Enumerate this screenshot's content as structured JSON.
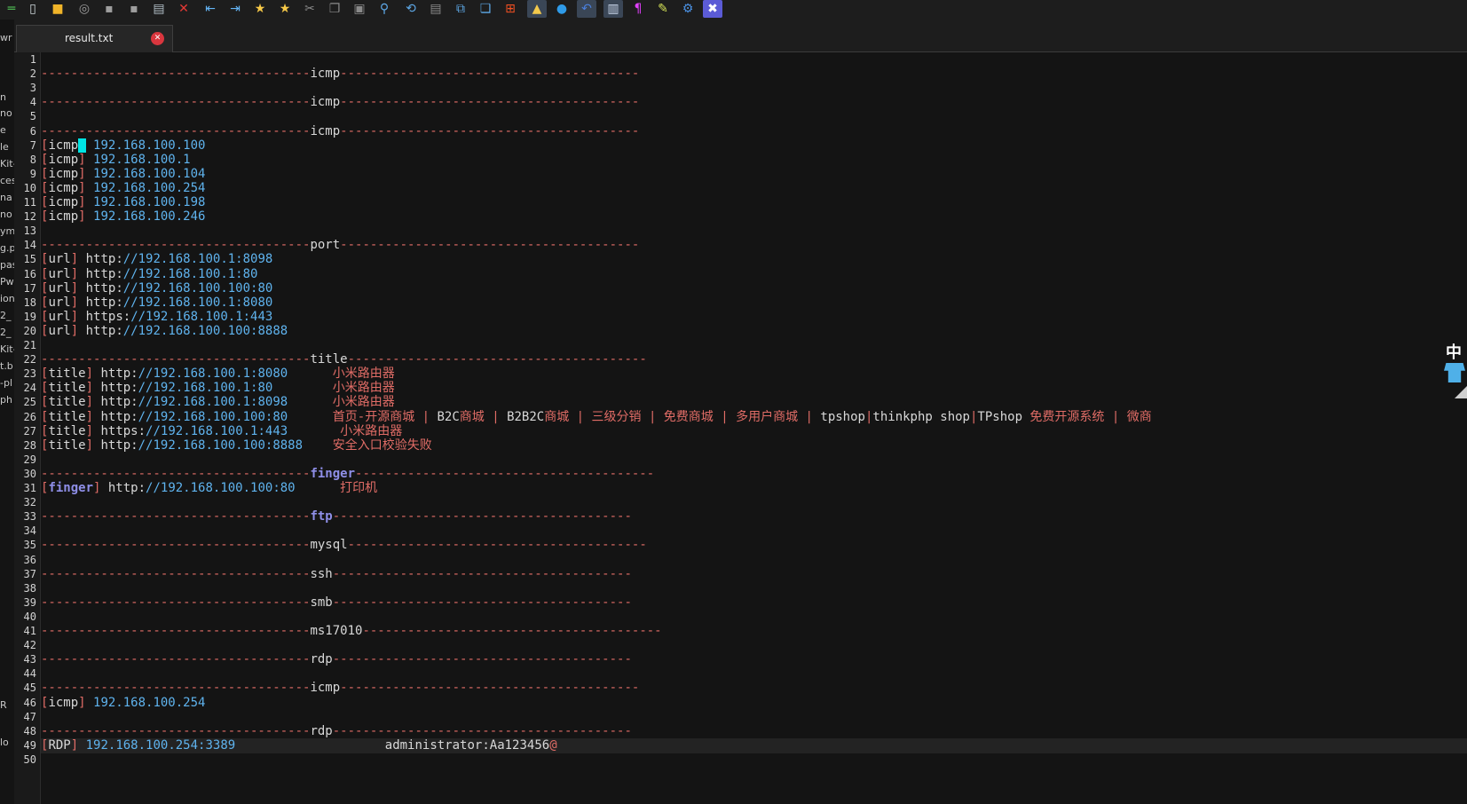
{
  "toolbar": {
    "buttons": [
      {
        "name": "menu-edge-icon",
        "glyph": "═",
        "color": "#4caf50"
      },
      {
        "name": "new-file-icon",
        "glyph": "▯",
        "color": "#cfd8dc"
      },
      {
        "name": "open-folder-icon",
        "glyph": "■",
        "color": "#f0b429"
      },
      {
        "name": "reload-icon",
        "glyph": "◎",
        "color": "#9e9e9e"
      },
      {
        "name": "save-icon",
        "glyph": "▪",
        "color": "#9e9e9e"
      },
      {
        "name": "save-all-icon",
        "glyph": "▪",
        "color": "#9e9e9e"
      },
      {
        "name": "print-icon",
        "glyph": "▤",
        "color": "#b0bec5"
      },
      {
        "name": "close-icon",
        "glyph": "✕",
        "color": "#e53935"
      },
      {
        "name": "unindent-icon",
        "glyph": "⇤",
        "color": "#64b5f6"
      },
      {
        "name": "indent-icon",
        "glyph": "⇥",
        "color": "#64b5f6"
      },
      {
        "name": "bookmark-icon",
        "glyph": "★",
        "color": "#f7c948"
      },
      {
        "name": "bookmark-next-icon",
        "glyph": "★",
        "color": "#f7c948"
      },
      {
        "name": "cut-icon",
        "glyph": "✂",
        "color": "#8a8a8a"
      },
      {
        "name": "copy-icon",
        "glyph": "❐",
        "color": "#8a8a8a"
      },
      {
        "name": "paste-icon",
        "glyph": "▣",
        "color": "#8a8a8a"
      },
      {
        "name": "find-icon",
        "glyph": "⚲",
        "color": "#5ea9e8"
      },
      {
        "name": "find-replace-icon",
        "glyph": "⟲",
        "color": "#5ea9e8"
      },
      {
        "name": "document-icon",
        "glyph": "▤",
        "color": "#8a8a8a"
      },
      {
        "name": "compare-icon",
        "glyph": "⧉",
        "color": "#5ea9e8"
      },
      {
        "name": "window-icon",
        "glyph": "❏",
        "color": "#5ea9e8"
      },
      {
        "name": "windows-logo-icon",
        "glyph": "⊞",
        "color": "#f25022"
      },
      {
        "name": "linux-icon",
        "glyph": "▲",
        "color": "#f2c94c",
        "pressed": true
      },
      {
        "name": "apple-icon",
        "glyph": "●",
        "color": "#2f9be8"
      },
      {
        "name": "undo-icon",
        "glyph": "↶",
        "color": "#4a7fdc",
        "pressed": true
      },
      {
        "name": "panel-icon",
        "glyph": "▥",
        "color": "#c9d6ea",
        "pressed": true
      },
      {
        "name": "pilcrow-icon",
        "glyph": "¶",
        "color": "#e040fb"
      },
      {
        "name": "pen-icon",
        "glyph": "✎",
        "color": "#d4e157"
      },
      {
        "name": "settings-icon",
        "glyph": "⚙",
        "color": "#4a90e2"
      },
      {
        "name": "close-box-icon",
        "glyph": "✖",
        "color": "#ffffff",
        "bg": "#5b5bd6"
      }
    ]
  },
  "left_strip": [
    "wr",
    "n",
    "no",
    "e",
    "le",
    "Kit-",
    "ces",
    "na",
    "no",
    "ym",
    "g.p",
    "pas",
    "Pwo",
    "ion",
    "2_",
    "2_",
    "Kit-",
    "t.b",
    "-pl",
    "ph",
    "R",
    "lo"
  ],
  "tab": {
    "label": "result.txt",
    "close_glyph": "✕"
  },
  "colors": {
    "accent_dash": "#e06c66",
    "ip_blue": "#5fb3ee",
    "finger_purple": "#8f8fe8",
    "cursor": "#00e5e5"
  },
  "lines": [
    {
      "n": "1",
      "segs": []
    },
    {
      "n": "2",
      "segs": [
        {
          "t": "------------------------------------",
          "c": "dash"
        },
        {
          "t": "icmp",
          "c": "tag"
        },
        {
          "t": "----------------------------------------",
          "c": "dash"
        }
      ]
    },
    {
      "n": "3",
      "segs": []
    },
    {
      "n": "4",
      "segs": [
        {
          "t": "------------------------------------",
          "c": "dash"
        },
        {
          "t": "icmp",
          "c": "tag"
        },
        {
          "t": "----------------------------------------",
          "c": "dash"
        }
      ]
    },
    {
      "n": "5",
      "segs": []
    },
    {
      "n": "6",
      "segs": [
        {
          "t": "------------------------------------",
          "c": "dash"
        },
        {
          "t": "icmp",
          "c": "tag"
        },
        {
          "t": "----------------------------------------",
          "c": "dash"
        }
      ]
    },
    {
      "n": "7",
      "segs": [
        {
          "t": "[",
          "c": "br"
        },
        {
          "t": "icmp",
          "c": "tag"
        },
        {
          "t": "]",
          "c": "cursor"
        },
        {
          "t": " 192.168.100.100",
          "c": "ip"
        }
      ]
    },
    {
      "n": "8",
      "segs": [
        {
          "t": "[",
          "c": "br"
        },
        {
          "t": "icmp",
          "c": "tag"
        },
        {
          "t": "]",
          "c": "br"
        },
        {
          "t": " 192.168.100.1",
          "c": "ip"
        }
      ]
    },
    {
      "n": "9",
      "segs": [
        {
          "t": "[",
          "c": "br"
        },
        {
          "t": "icmp",
          "c": "tag"
        },
        {
          "t": "]",
          "c": "br"
        },
        {
          "t": " 192.168.100.104",
          "c": "ip"
        }
      ]
    },
    {
      "n": "10",
      "segs": [
        {
          "t": "[",
          "c": "br"
        },
        {
          "t": "icmp",
          "c": "tag"
        },
        {
          "t": "]",
          "c": "br"
        },
        {
          "t": " 192.168.100.254",
          "c": "ip"
        }
      ]
    },
    {
      "n": "11",
      "segs": [
        {
          "t": "[",
          "c": "br"
        },
        {
          "t": "icmp",
          "c": "tag"
        },
        {
          "t": "]",
          "c": "br"
        },
        {
          "t": " 192.168.100.198",
          "c": "ip"
        }
      ]
    },
    {
      "n": "12",
      "segs": [
        {
          "t": "[",
          "c": "br"
        },
        {
          "t": "icmp",
          "c": "tag"
        },
        {
          "t": "]",
          "c": "br"
        },
        {
          "t": " 192.168.100.246",
          "c": "ip"
        }
      ]
    },
    {
      "n": "13",
      "segs": []
    },
    {
      "n": "14",
      "segs": [
        {
          "t": "------------------------------------",
          "c": "dash"
        },
        {
          "t": "port",
          "c": "tag"
        },
        {
          "t": "----------------------------------------",
          "c": "dash"
        }
      ]
    },
    {
      "n": "15",
      "segs": [
        {
          "t": "[",
          "c": "br"
        },
        {
          "t": "url",
          "c": "tag"
        },
        {
          "t": "]",
          "c": "br"
        },
        {
          "t": " http:",
          "c": "url"
        },
        {
          "t": "//192.168.100.1:8098",
          "c": "url-rest"
        }
      ]
    },
    {
      "n": "16",
      "segs": [
        {
          "t": "[",
          "c": "br"
        },
        {
          "t": "url",
          "c": "tag"
        },
        {
          "t": "]",
          "c": "br"
        },
        {
          "t": " http:",
          "c": "url"
        },
        {
          "t": "//192.168.100.1:80",
          "c": "url-rest"
        }
      ]
    },
    {
      "n": "17",
      "segs": [
        {
          "t": "[",
          "c": "br"
        },
        {
          "t": "url",
          "c": "tag"
        },
        {
          "t": "]",
          "c": "br"
        },
        {
          "t": " http:",
          "c": "url"
        },
        {
          "t": "//192.168.100.100:80",
          "c": "url-rest"
        }
      ]
    },
    {
      "n": "18",
      "segs": [
        {
          "t": "[",
          "c": "br"
        },
        {
          "t": "url",
          "c": "tag"
        },
        {
          "t": "]",
          "c": "br"
        },
        {
          "t": " http:",
          "c": "url"
        },
        {
          "t": "//192.168.100.1:8080",
          "c": "url-rest"
        }
      ]
    },
    {
      "n": "19",
      "segs": [
        {
          "t": "[",
          "c": "br"
        },
        {
          "t": "url",
          "c": "tag"
        },
        {
          "t": "]",
          "c": "br"
        },
        {
          "t": " https:",
          "c": "url"
        },
        {
          "t": "//192.168.100.1:443",
          "c": "url-rest"
        }
      ]
    },
    {
      "n": "20",
      "segs": [
        {
          "t": "[",
          "c": "br"
        },
        {
          "t": "url",
          "c": "tag"
        },
        {
          "t": "]",
          "c": "br"
        },
        {
          "t": " http:",
          "c": "url"
        },
        {
          "t": "//192.168.100.100:8888",
          "c": "url-rest"
        }
      ]
    },
    {
      "n": "21",
      "segs": []
    },
    {
      "n": "22",
      "segs": [
        {
          "t": "------------------------------------",
          "c": "dash"
        },
        {
          "t": "title",
          "c": "tag"
        },
        {
          "t": "----------------------------------------",
          "c": "dash"
        }
      ]
    },
    {
      "n": "23",
      "segs": [
        {
          "t": "[",
          "c": "br"
        },
        {
          "t": "title",
          "c": "tag"
        },
        {
          "t": "]",
          "c": "br"
        },
        {
          "t": " http:",
          "c": "url"
        },
        {
          "t": "//192.168.100.1:8080",
          "c": "url-rest"
        },
        {
          "t": "      小米路由器",
          "c": "cn"
        }
      ]
    },
    {
      "n": "24",
      "segs": [
        {
          "t": "[",
          "c": "br"
        },
        {
          "t": "title",
          "c": "tag"
        },
        {
          "t": "]",
          "c": "br"
        },
        {
          "t": " http:",
          "c": "url"
        },
        {
          "t": "//192.168.100.1:80",
          "c": "url-rest"
        },
        {
          "t": "        小米路由器",
          "c": "cn"
        }
      ]
    },
    {
      "n": "25",
      "segs": [
        {
          "t": "[",
          "c": "br"
        },
        {
          "t": "title",
          "c": "tag"
        },
        {
          "t": "]",
          "c": "br"
        },
        {
          "t": " http:",
          "c": "url"
        },
        {
          "t": "//192.168.100.1:8098",
          "c": "url-rest"
        },
        {
          "t": "      小米路由器",
          "c": "cn"
        }
      ]
    },
    {
      "n": "26",
      "segs": [
        {
          "t": "[",
          "c": "br"
        },
        {
          "t": "title",
          "c": "tag"
        },
        {
          "t": "]",
          "c": "br"
        },
        {
          "t": " http:",
          "c": "url"
        },
        {
          "t": "//192.168.100.100:80",
          "c": "url-rest"
        },
        {
          "t": "      首页-开源商城 | ",
          "c": "cn"
        },
        {
          "t": "B2C",
          "c": "sep"
        },
        {
          "t": "商城 | ",
          "c": "cn"
        },
        {
          "t": "B2B2C",
          "c": "sep"
        },
        {
          "t": "商城 | 三级分销 | 免费商城 | 多用户商城 | ",
          "c": "cn"
        },
        {
          "t": "tpshop",
          "c": "sep"
        },
        {
          "t": "|",
          "c": "cn"
        },
        {
          "t": "thinkphp shop",
          "c": "sep"
        },
        {
          "t": "|",
          "c": "cn"
        },
        {
          "t": "TPshop",
          "c": "sep"
        },
        {
          "t": " 免费开源系统 | 微商",
          "c": "cn"
        }
      ]
    },
    {
      "n": "27",
      "segs": [
        {
          "t": "[",
          "c": "br"
        },
        {
          "t": "title",
          "c": "tag"
        },
        {
          "t": "]",
          "c": "br"
        },
        {
          "t": " https:",
          "c": "url"
        },
        {
          "t": "//192.168.100.1:443",
          "c": "url-rest"
        },
        {
          "t": "       小米路由器",
          "c": "cn"
        }
      ]
    },
    {
      "n": "28",
      "segs": [
        {
          "t": "[",
          "c": "br"
        },
        {
          "t": "title",
          "c": "tag"
        },
        {
          "t": "]",
          "c": "br"
        },
        {
          "t": " http:",
          "c": "url"
        },
        {
          "t": "//192.168.100.100:8888",
          "c": "url-rest"
        },
        {
          "t": "    安全入口校验失败",
          "c": "cn"
        }
      ]
    },
    {
      "n": "29",
      "segs": []
    },
    {
      "n": "30",
      "segs": [
        {
          "t": "------------------------------------",
          "c": "dash"
        },
        {
          "t": "finger",
          "c": "tag-f"
        },
        {
          "t": "----------------------------------------",
          "c": "dash"
        }
      ]
    },
    {
      "n": "31",
      "segs": [
        {
          "t": "[",
          "c": "br"
        },
        {
          "t": "finger",
          "c": "tag-f"
        },
        {
          "t": "]",
          "c": "br"
        },
        {
          "t": " http:",
          "c": "url"
        },
        {
          "t": "//192.168.100.100:80",
          "c": "url-rest"
        },
        {
          "t": "      打印机",
          "c": "cn"
        }
      ]
    },
    {
      "n": "32",
      "segs": []
    },
    {
      "n": "33",
      "segs": [
        {
          "t": "------------------------------------",
          "c": "dash"
        },
        {
          "t": "ftp",
          "c": "tag-f"
        },
        {
          "t": "----------------------------------------",
          "c": "dash"
        }
      ]
    },
    {
      "n": "34",
      "segs": []
    },
    {
      "n": "35",
      "segs": [
        {
          "t": "------------------------------------",
          "c": "dash"
        },
        {
          "t": "mysql",
          "c": "tag"
        },
        {
          "t": "----------------------------------------",
          "c": "dash"
        }
      ]
    },
    {
      "n": "36",
      "segs": []
    },
    {
      "n": "37",
      "segs": [
        {
          "t": "------------------------------------",
          "c": "dash"
        },
        {
          "t": "ssh",
          "c": "tag"
        },
        {
          "t": "----------------------------------------",
          "c": "dash"
        }
      ]
    },
    {
      "n": "38",
      "segs": []
    },
    {
      "n": "39",
      "segs": [
        {
          "t": "------------------------------------",
          "c": "dash"
        },
        {
          "t": "smb",
          "c": "tag"
        },
        {
          "t": "----------------------------------------",
          "c": "dash"
        }
      ]
    },
    {
      "n": "40",
      "segs": []
    },
    {
      "n": "41",
      "segs": [
        {
          "t": "------------------------------------",
          "c": "dash"
        },
        {
          "t": "ms17010",
          "c": "tag"
        },
        {
          "t": "----------------------------------------",
          "c": "dash"
        }
      ]
    },
    {
      "n": "42",
      "segs": []
    },
    {
      "n": "43",
      "segs": [
        {
          "t": "------------------------------------",
          "c": "dash"
        },
        {
          "t": "rdp",
          "c": "tag"
        },
        {
          "t": "----------------------------------------",
          "c": "dash"
        }
      ]
    },
    {
      "n": "44",
      "segs": []
    },
    {
      "n": "45",
      "segs": [
        {
          "t": "------------------------------------",
          "c": "dash"
        },
        {
          "t": "icmp",
          "c": "tag"
        },
        {
          "t": "----------------------------------------",
          "c": "dash"
        }
      ]
    },
    {
      "n": "46",
      "segs": [
        {
          "t": "[",
          "c": "br"
        },
        {
          "t": "icmp",
          "c": "tag"
        },
        {
          "t": "]",
          "c": "br"
        },
        {
          "t": " 192.168.100.254",
          "c": "ip"
        }
      ]
    },
    {
      "n": "47",
      "segs": []
    },
    {
      "n": "48",
      "segs": [
        {
          "t": "------------------------------------",
          "c": "dash"
        },
        {
          "t": "rdp",
          "c": "tag"
        },
        {
          "t": "----------------------------------------",
          "c": "dash"
        }
      ]
    },
    {
      "n": "49",
      "active": true,
      "segs": [
        {
          "t": "[",
          "c": "br"
        },
        {
          "t": "RDP",
          "c": "tag"
        },
        {
          "t": "]",
          "c": "br"
        },
        {
          "t": " 192.168.100.254:3389",
          "c": "ip"
        },
        {
          "t": "                    administrator:Aa123456",
          "c": "url"
        },
        {
          "t": "@",
          "c": "cn"
        }
      ]
    },
    {
      "n": "50",
      "segs": []
    }
  ],
  "right_edge": {
    "ime_glyph": "中"
  }
}
